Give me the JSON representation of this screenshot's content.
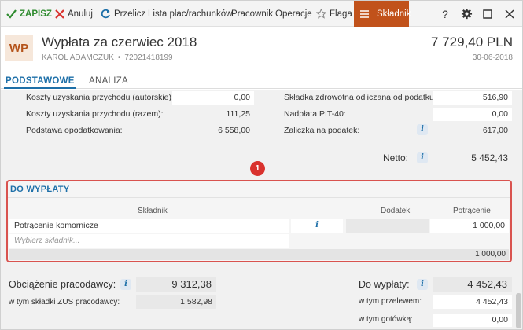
{
  "toolbar": {
    "save": "ZAPISZ",
    "cancel": "Anuluj",
    "recalc": "Przelicz",
    "payroll_list": "Lista płac/rachunków",
    "employee": "Pracownik",
    "operations": "Operacje",
    "flag": "Flaga",
    "component": "Składnik",
    "help": "?"
  },
  "header": {
    "badge": "WP",
    "title": "Wypłata za czerwiec 2018",
    "employee_name": "KAROL ADAMCZUK",
    "separator": "•",
    "employee_id": "72021418199",
    "amount": "7 729,40 PLN",
    "date": "30-06-2018"
  },
  "tabs": [
    {
      "label": "PODSTAWOWE",
      "active": true
    },
    {
      "label": "ANALIZA",
      "active": false
    }
  ],
  "fields_left": [
    {
      "label": "Koszty uzyskania przychodu (autorskie):",
      "value": "0,00"
    },
    {
      "label": "Koszty uzyskania przychodu (razem):",
      "value": "111,25"
    },
    {
      "label": "Podstawa opodatkowania:",
      "value": "6 558,00"
    }
  ],
  "fields_right": [
    {
      "label": "Składka zdrowotna odliczana od podatku:",
      "value": "516,90"
    },
    {
      "label": "Nadpłata PIT-40:",
      "value": "0,00"
    },
    {
      "label": "Zaliczka na podatek:",
      "value": "617,00"
    }
  ],
  "netto": {
    "label": "Netto:",
    "value": "5 452,43"
  },
  "marker": "1",
  "payout_section": {
    "title": "DO WYPŁATY",
    "columns": [
      "Składnik",
      "Dodatek",
      "Potrącenie"
    ],
    "rows": [
      {
        "component": "Potrącenie komornicze",
        "addition": "",
        "deduction": "1 000,00"
      }
    ],
    "new_component_placeholder": "Wybierz składnik...",
    "total_deduction": "1 000,00"
  },
  "employer": {
    "label": "Obciążenie pracodawcy:",
    "value": "9 312,38",
    "zus_label": "w tym składki ZUS pracodawcy:",
    "zus_value": "1 582,98"
  },
  "payout": {
    "label": "Do wypłaty:",
    "value": "4 452,43",
    "transfer_label": "w tym przelewem:",
    "transfer_value": "4 452,43",
    "cash_label": "w tym gotówką:",
    "cash_value": "0,00"
  },
  "colors": {
    "accent_orange": "#c1521b",
    "accent_blue": "#1d6fa8",
    "save_green": "#2e8b2e",
    "highlight_red": "#d9534f"
  }
}
